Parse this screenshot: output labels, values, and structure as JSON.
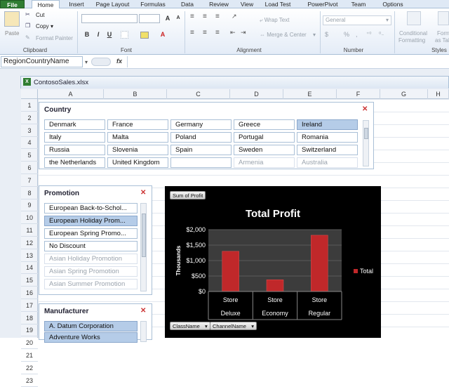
{
  "ribbon_tabs": [
    "File",
    "Home",
    "Insert",
    "Page Layout",
    "Formulas",
    "Data",
    "Review",
    "View",
    "Load Test",
    "PowerPivot",
    "Team",
    "Options"
  ],
  "active_tab": "Home",
  "ribbon": {
    "paste": "Paste",
    "cut": "Cut",
    "copy": "Copy",
    "copy_arrow": "▾",
    "format_painter": "Format Painter",
    "clipboard": "Clipboard",
    "font_group": "Font",
    "alignment": "Alignment",
    "wrap_text": "Wrap Text",
    "merge_center": "Merge & Center",
    "number_group": "Number",
    "number_format": "General",
    "currency": "$",
    "percent": "%",
    "comma": ",",
    "conditional_formatting_1": "Conditional",
    "conditional_formatting_2": "Formatting",
    "format_as_table_1": "Forma",
    "format_as_table_2": "as Tab",
    "styles": "Styles",
    "bold": "B",
    "italic": "I",
    "underline": "U",
    "grow": "A",
    "shrink": "A"
  },
  "formula_bar": {
    "name_box": "RegionCountryName",
    "fx": "fx",
    "value": ""
  },
  "workbook_title": "ContosoSales.xlsx",
  "columns": [
    "A",
    "B",
    "C",
    "D",
    "E",
    "F",
    "G",
    "H"
  ],
  "rows": [
    "1",
    "2",
    "3",
    "4",
    "5",
    "6",
    "7",
    "8",
    "9",
    "10",
    "11",
    "12",
    "13",
    "14",
    "15",
    "16",
    "17",
    "18",
    "19",
    "20",
    "21",
    "22",
    "23"
  ],
  "country_slicer": {
    "title": "Country",
    "items": [
      {
        "label": "Denmark",
        "state": "normal"
      },
      {
        "label": "France",
        "state": "normal"
      },
      {
        "label": "Germany",
        "state": "normal"
      },
      {
        "label": "Greece",
        "state": "normal"
      },
      {
        "label": "Ireland",
        "state": "selected"
      },
      {
        "label": "Italy",
        "state": "normal"
      },
      {
        "label": "Malta",
        "state": "normal"
      },
      {
        "label": "Poland",
        "state": "normal"
      },
      {
        "label": "Portugal",
        "state": "normal"
      },
      {
        "label": "Romania",
        "state": "normal"
      },
      {
        "label": "Russia",
        "state": "normal"
      },
      {
        "label": "Slovenia",
        "state": "normal"
      },
      {
        "label": "Spain",
        "state": "normal"
      },
      {
        "label": "Sweden",
        "state": "normal"
      },
      {
        "label": "Switzerland",
        "state": "normal"
      },
      {
        "label": "the Netherlands",
        "state": "normal"
      },
      {
        "label": "United Kingdom",
        "state": "normal"
      },
      {
        "label": "",
        "state": "normal"
      },
      {
        "label": "Armenia",
        "state": "nodata"
      },
      {
        "label": "Australia",
        "state": "nodata"
      }
    ]
  },
  "promotion_slicer": {
    "title": "Promotion",
    "items": [
      {
        "label": "European Back-to-Schol...",
        "state": "normal"
      },
      {
        "label": "European Holiday Prom...",
        "state": "selected"
      },
      {
        "label": "European Spring Promo...",
        "state": "normal"
      },
      {
        "label": "No Discount",
        "state": "normal"
      },
      {
        "label": "Asian Holiday Promotion",
        "state": "nodata"
      },
      {
        "label": "Asian Spring Promotion",
        "state": "nodata"
      },
      {
        "label": "Asian Summer Promotion",
        "state": "nodata"
      }
    ]
  },
  "manufacturer_slicer": {
    "title": "Manufacturer",
    "items": [
      {
        "label": "A. Datum Corporation",
        "state": "selected"
      },
      {
        "label": "Adventure Works",
        "state": "selected"
      }
    ]
  },
  "clear_filter_icon": "✕",
  "colors": {
    "chart_bg": "#000000",
    "bar": "#c0282a",
    "plot_bg": "#3c3c3c",
    "selected": "#b5cce8",
    "file_tab": "#2f7d32"
  },
  "chart_data": {
    "type": "bar",
    "title": "Total Profit",
    "ylabel": "Thousands",
    "field_button": "Sum of Profit",
    "legend": "Total",
    "categories": [
      [
        "Store",
        "Deluxe"
      ],
      [
        "Store",
        "Economy"
      ],
      [
        "Store",
        "Regular"
      ]
    ],
    "values": [
      1300,
      380,
      1820
    ],
    "yticks": [
      "$0",
      "$500",
      "$1,000",
      "$1,500",
      "$2,000"
    ],
    "ylim": [
      0,
      2000
    ],
    "axis_fields": [
      "ClassName",
      "ChannelName"
    ],
    "grid": true,
    "legend_position": "right"
  }
}
